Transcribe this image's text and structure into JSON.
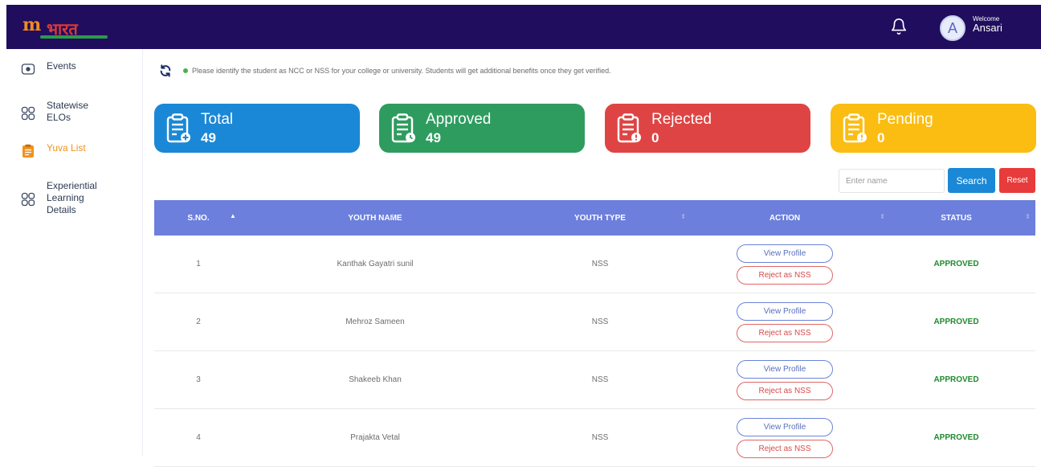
{
  "header": {
    "logo_mark": "m",
    "logo_word": "भारत",
    "welcome_label": "Welcome",
    "user_name": "Ansari",
    "avatar_initial": "A"
  },
  "sidebar": {
    "items": [
      {
        "label": "Events",
        "icon": "event-icon",
        "active": false
      },
      {
        "label": "Statewise ELOs",
        "icon": "grid-icon",
        "active": false
      },
      {
        "label": "Yuva List",
        "icon": "clipboard-icon",
        "active": true
      },
      {
        "label": "Experiential Learning Details",
        "icon": "grid-icon",
        "active": false
      }
    ]
  },
  "notice": {
    "text": "Please identify the student as NCC or NSS for your college or university. Students will get additional benefits once they get verified."
  },
  "cards": [
    {
      "title": "Total",
      "count": "49",
      "color": "#1a88d6"
    },
    {
      "title": "Approved",
      "count": "49",
      "color": "#2e9c5f"
    },
    {
      "title": "Rejected",
      "count": "0",
      "color": "#df4444"
    },
    {
      "title": "Pending",
      "count": "0",
      "color": "#fbbd12"
    }
  ],
  "search": {
    "placeholder": "Enter name",
    "value": "",
    "search_label": "Search",
    "reset_label": "Reset"
  },
  "table": {
    "headers": [
      "S.NO.",
      "YOUTH NAME",
      "YOUTH TYPE",
      "ACTION",
      "STATUS"
    ],
    "rows": [
      {
        "sno": "1",
        "name": "Kanthak Gayatri sunil",
        "type": "NSS",
        "view": "View Profile",
        "reject": "Reject as NSS",
        "status": "APPROVED"
      },
      {
        "sno": "2",
        "name": "Mehroz Sameen",
        "type": "NSS",
        "view": "View Profile",
        "reject": "Reject as NSS",
        "status": "APPROVED"
      },
      {
        "sno": "3",
        "name": "Shakeeb Khan",
        "type": "NSS",
        "view": "View Profile",
        "reject": "Reject as NSS",
        "status": "APPROVED"
      },
      {
        "sno": "4",
        "name": "Prajakta Vetal",
        "type": "NSS",
        "view": "View Profile",
        "reject": "Reject as NSS",
        "status": "APPROVED"
      }
    ]
  }
}
